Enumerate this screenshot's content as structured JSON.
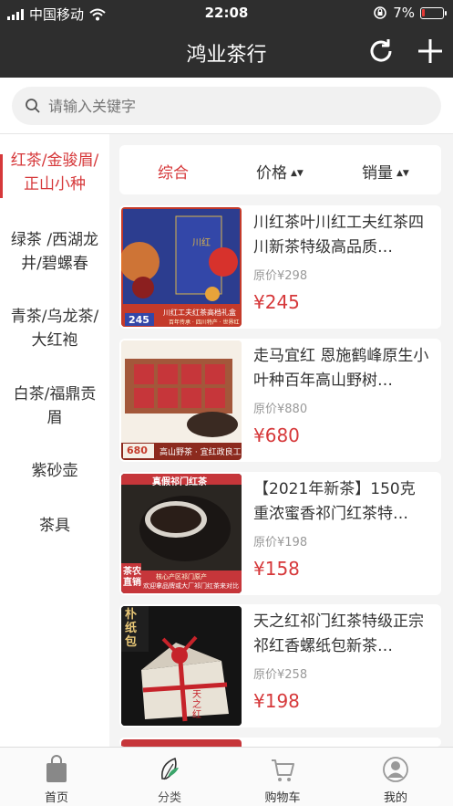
{
  "status": {
    "carrier": "中国移动",
    "time": "22:08",
    "battery": "7%"
  },
  "header": {
    "title": "鸿业茶行"
  },
  "search": {
    "placeholder": "请输入关键字"
  },
  "categories": [
    {
      "label1": "红茶/金骏眉/",
      "label2": "正山小种"
    },
    {
      "label1": "绿茶 /西湖龙",
      "label2": "井/碧螺春"
    },
    {
      "label1": "青茶/乌龙茶/",
      "label2": "大红袍"
    },
    {
      "label1": "白茶/福鼎贡",
      "label2": "眉"
    },
    {
      "label1": "紫砂壶",
      "label2": ""
    },
    {
      "label1": "茶具",
      "label2": ""
    }
  ],
  "sort": {
    "overall": "综合",
    "price": "价格",
    "sales": "销量"
  },
  "products": [
    {
      "name": "川红茶叶川红工夫红茶四川新茶特级高品质…",
      "orig": "原价¥298",
      "price": "¥245",
      "img_badge": "245",
      "img_caption": "川红工夫红茶高档礼盒",
      "img_caption2": "百年传承 · 四川特产 · 世界红",
      "img_title": "川红"
    },
    {
      "name": "走马宜红 恩施鹤峰原生小叶种百年高山野树…",
      "orig": "原价¥880",
      "price": "¥680",
      "img_badge": "680",
      "img_caption": "高山野茶 · 宜红政良工艺"
    },
    {
      "name": "【2021年新茶】150克重浓蜜香祁门红茶特…",
      "orig": "原价¥198",
      "price": "¥158",
      "img_top": "真假祁门红茶",
      "img_side": "茶农直销",
      "img_caption": "欢迎拿品牌或大厂祁门红茶来对比",
      "img_caption2": "核心产区祁门原产"
    },
    {
      "name": "天之红祁门红茶特级正宗祁红香螺纸包新茶…",
      "orig": "原价¥258",
      "price": "¥198",
      "img_side": "朴纸包",
      "img_caption": "天之红"
    }
  ],
  "tabs": [
    {
      "label": "首页",
      "icon": "home-bag-icon"
    },
    {
      "label": "分类",
      "icon": "leaf-category-icon"
    },
    {
      "label": "购物车",
      "icon": "cart-icon"
    },
    {
      "label": "我的",
      "icon": "profile-icon"
    }
  ],
  "colors": {
    "accent": "#d6383a",
    "header_bg": "#2e2e2e"
  }
}
